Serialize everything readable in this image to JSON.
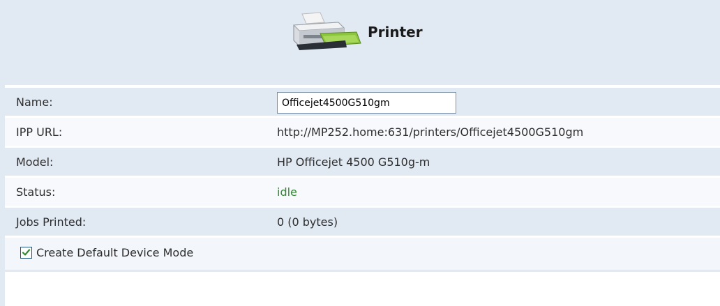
{
  "header": {
    "title": "Printer",
    "icon": "printer-icon"
  },
  "fields": {
    "name": {
      "label": "Name:",
      "value": "Officejet4500G510gm"
    },
    "ipp_url": {
      "label": "IPP URL:",
      "value": "http://MP252.home:631/printers/Officejet4500G510gm"
    },
    "model": {
      "label": "Model:",
      "value": "HP Officejet 4500 G510g-m"
    },
    "status": {
      "label": "Status:",
      "value": "idle"
    },
    "jobs_printed": {
      "label": "Jobs Printed:",
      "value": "0 (0 bytes)"
    }
  },
  "create_default_device_mode": {
    "label": "Create Default Device Mode",
    "checked": true
  },
  "colors": {
    "band": "#e1e9f3",
    "status_idle": "#2e8b2e",
    "checkbox_border": "#1c5180",
    "checkmark": "#2e8b2e"
  }
}
